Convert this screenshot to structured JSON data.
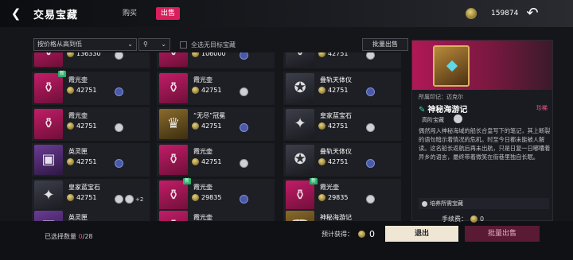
{
  "header": {
    "title": "交易宝藏",
    "tab_buy": "购买",
    "tab_sell": "出售",
    "currency": "159874"
  },
  "toolbar": {
    "sort": "按价格从高到低",
    "select_all": "全选无目标宝藏",
    "batch_sell": "批量出售"
  },
  "grid": {
    "items": [
      {
        "name": "",
        "price": "136330",
        "rarity": "pink",
        "glyph": "⚱"
      },
      {
        "name": "",
        "price": "106000",
        "rarity": "pink",
        "glyph": "⚱"
      },
      {
        "name": "",
        "price": "42751",
        "rarity": "dark",
        "glyph": "⚱"
      },
      {
        "name": "霞光壶",
        "price": "42751",
        "rarity": "pink",
        "glyph": "⚱",
        "new": "新"
      },
      {
        "name": "霞光壶",
        "price": "42751",
        "rarity": "pink",
        "glyph": "⚱"
      },
      {
        "name": "叠轨天体仪",
        "price": "42751",
        "rarity": "dark",
        "glyph": "✪"
      },
      {
        "name": "霞光壶",
        "price": "42751",
        "rarity": "pink",
        "glyph": "⚱"
      },
      {
        "name": "“无尽”冠冕",
        "price": "42751",
        "rarity": "gold",
        "glyph": "♛"
      },
      {
        "name": "皇家蓝宝石",
        "price": "42751",
        "rarity": "dark",
        "glyph": "✦"
      },
      {
        "name": "英灵匣",
        "price": "42751",
        "rarity": "purple",
        "glyph": "▣"
      },
      {
        "name": "霞光壶",
        "price": "42751",
        "rarity": "pink",
        "glyph": "⚱"
      },
      {
        "name": "叠轨天体仪",
        "price": "42751",
        "rarity": "dark",
        "glyph": "✪"
      },
      {
        "name": "皇家蓝宝石",
        "price": "42751",
        "rarity": "dark",
        "glyph": "✦",
        "extra": "+2"
      },
      {
        "name": "霞光壶",
        "price": "29835",
        "rarity": "pink",
        "glyph": "⚱",
        "new": "新"
      },
      {
        "name": "霞光壶",
        "price": "29835",
        "rarity": "pink",
        "glyph": "⚱",
        "new": "新"
      },
      {
        "name": "英灵匣",
        "price": "",
        "rarity": "purple",
        "glyph": "▣"
      },
      {
        "name": "霞光壶",
        "price": "",
        "rarity": "pink",
        "glyph": "⚱"
      },
      {
        "name": "神秘海游记",
        "price": "",
        "rarity": "gold",
        "glyph": "📖"
      }
    ]
  },
  "detail": {
    "source": "所属印记：迈克尔",
    "name": "神秘海游记",
    "rarity": "珍稀",
    "owner": "高阶宝藏",
    "description": "偶然闯入神秘海域的船长合皇写下的笔记，其上断裂的语句暗示着情况的危机。时至今日都未能被人解读。这名船长返航后再未出航，只是日复一日嘟囔着异乡的语言，最终带着微笑在街巷里独自长眠。",
    "upkeep_label": "培养所需宝藏"
  },
  "bottom": {
    "selected_label": "已选择数量",
    "selected_count": "0",
    "selected_total": "/28",
    "fee_label": "手续费：",
    "fee_value": "0",
    "expect_label": "预计获得：",
    "expect_value": "0",
    "exit_label": "退出",
    "batch_sell_label": "批量出售"
  },
  "colors": {
    "accent": "#d81e5b",
    "pink_rarity": "#c21d68",
    "gold_rarity": "#8a6b2a"
  }
}
